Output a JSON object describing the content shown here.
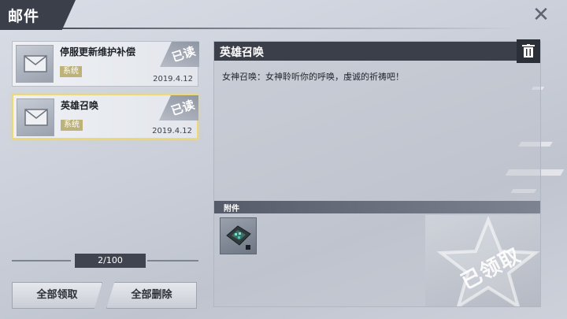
{
  "header": {
    "title": "邮件",
    "close_icon": "close-x-icon"
  },
  "mails": [
    {
      "subject": "停服更新维护补偿",
      "tag": "系统",
      "date": "2019.4.12",
      "status": "已读",
      "selected": false
    },
    {
      "subject": "英雄召唤",
      "tag": "系统",
      "date": "2019.4.12",
      "status": "已读",
      "selected": true
    }
  ],
  "pagination": {
    "text": "2/100"
  },
  "actions": {
    "claim_all": "全部领取",
    "delete_all": "全部删除"
  },
  "detail": {
    "title": "英雄召唤",
    "body": "女神召唤：女神聆听你的呼唤，虔诚的祈祷吧！",
    "attachments_label": "附件",
    "claimed_stamp": "已领取"
  },
  "colors": {
    "header_bg": "#3a3f4a",
    "tag_bg": "#bdb27a",
    "selected_border": "#e9d97a"
  }
}
